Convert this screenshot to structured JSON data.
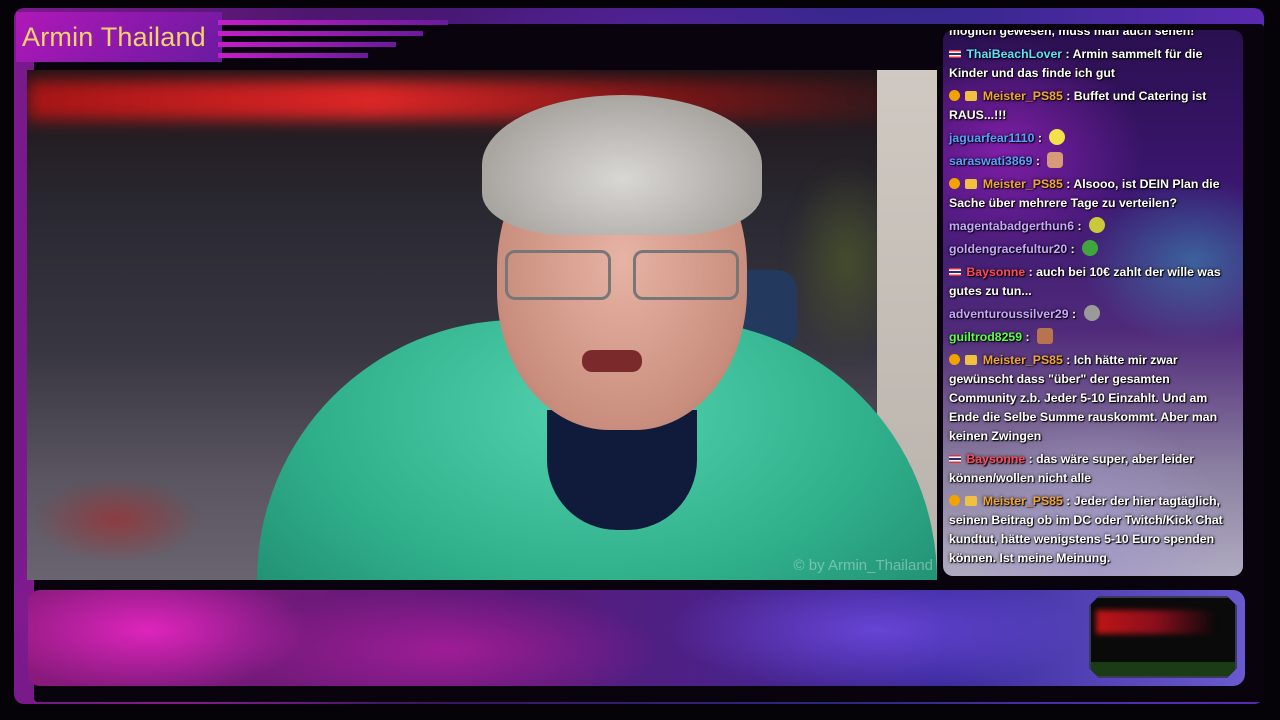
{
  "channel": {
    "title": "Armin Thailand"
  },
  "video": {
    "watermark": "© by Armin_Thailand"
  },
  "chat": {
    "messages": [
      {
        "badges": [],
        "user": "",
        "user_color": "#ffffff",
        "text": "der Übergabe... wäre das ABER alles NICHT möglich gewesen, muss man auch sehen!"
      },
      {
        "badges": [
          "flag"
        ],
        "user": "ThaiBeachLover",
        "user_color": "#5fe0ff",
        "text": "Armin sammelt für die Kinder und das finde ich gut"
      },
      {
        "badges": [
          "mod",
          "sub"
        ],
        "user": "Meister_PS85",
        "user_color": "#f0a63a",
        "text": "Buffet und Catering ist RAUS...!!!"
      },
      {
        "badges": [],
        "user": "jaguarfear1110",
        "user_color": "#5aa0ff",
        "text": "",
        "emote": "pikachu-emote"
      },
      {
        "badges": [],
        "user": "saraswati3869",
        "user_color": "#5aa0ff",
        "text": "",
        "emote": "face-emote"
      },
      {
        "badges": [
          "mod",
          "sub"
        ],
        "user": "Meister_PS85",
        "user_color": "#f0a63a",
        "text": "Alsooo, ist DEIN Plan die Sache über mehrere Tage zu verteilen?"
      },
      {
        "badges": [],
        "user": "magentabadgerthun6",
        "user_color": "#c9a6ff",
        "text": "",
        "emote": "blob-emote"
      },
      {
        "badges": [],
        "user": "goldengracefultur20",
        "user_color": "#c9a6ff",
        "text": "",
        "emote": "pepe-emote"
      },
      {
        "badges": [
          "flag"
        ],
        "user": "Baysonne",
        "user_color": "#ff4a5a",
        "text": "auch bei 10€ zahlt der wille was gutes zu tun..."
      },
      {
        "badges": [],
        "user": "adventuroussilver29",
        "user_color": "#c9a6ff",
        "text": "",
        "emote": "gray-emote"
      },
      {
        "badges": [],
        "user": "guiltrod8259",
        "user_color": "#5aff4a",
        "text": "",
        "emote": "man-emote"
      },
      {
        "badges": [
          "mod",
          "sub"
        ],
        "user": "Meister_PS85",
        "user_color": "#f0a63a",
        "text": "Ich hätte mir zwar gewünscht dass \"über\" der gesamten Community z.b. Jeder 5-10 Einzahlt. Und am Ende die Selbe Summe rauskommt. Aber man keinen Zwingen"
      },
      {
        "badges": [
          "flag"
        ],
        "user": "Baysonne",
        "user_color": "#ff4a5a",
        "text": "das wäre super, aber leider können/wollen nicht alle"
      },
      {
        "badges": [
          "mod",
          "sub"
        ],
        "user": "Meister_PS85",
        "user_color": "#f0a63a",
        "text": "Jeder der hier tagtäglich, seinen Beitrag ob im DC oder Twitch/Kick Chat kundtut, hätte wenigstens 5-10 Euro spenden können. Ist meine Meinung."
      }
    ]
  }
}
